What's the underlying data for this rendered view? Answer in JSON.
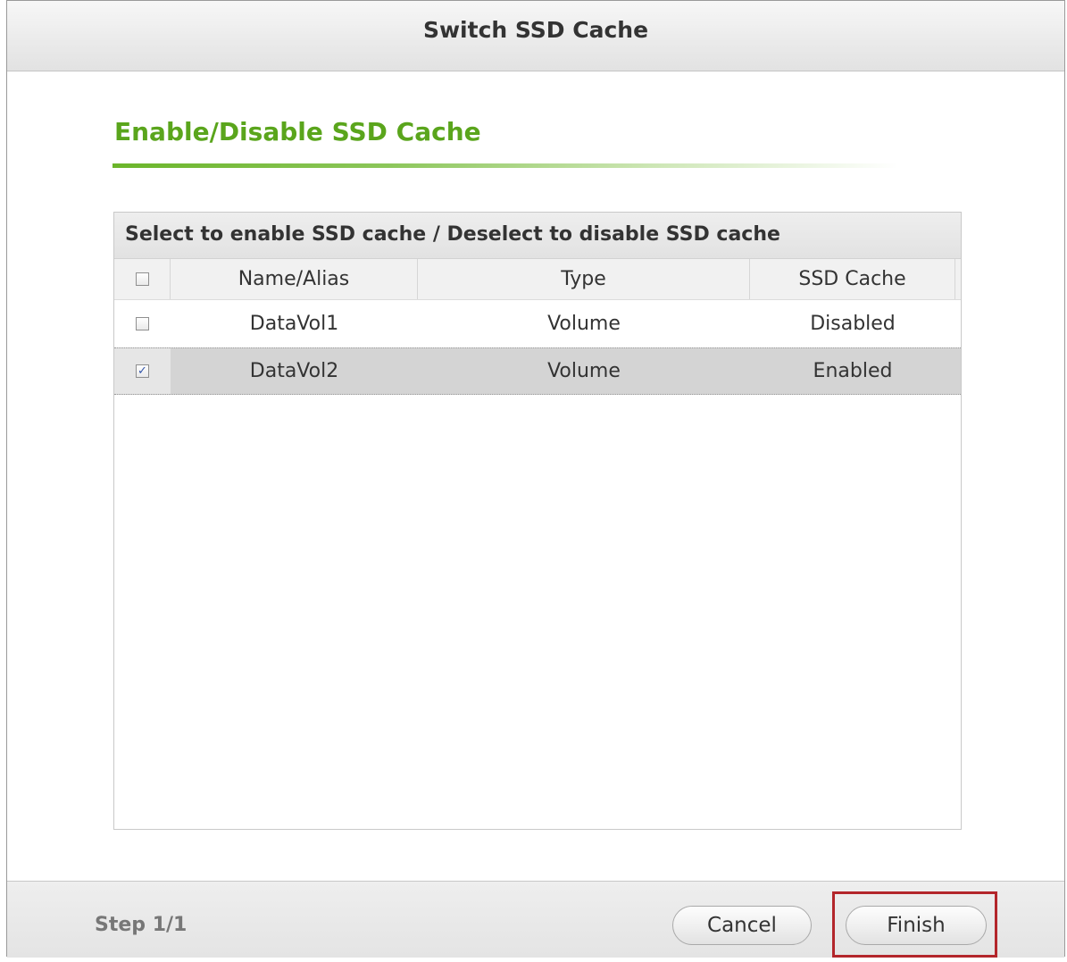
{
  "window": {
    "title": "Switch SSD Cache"
  },
  "section": {
    "title": "Enable/Disable SSD Cache"
  },
  "panel": {
    "header": "Select to enable SSD cache / Deselect to disable SSD cache",
    "columns": [
      "Name/Alias",
      "Type",
      "SSD Cache"
    ],
    "rows": [
      {
        "name": "DataVol1",
        "type": "Volume",
        "ssd_cache": "Disabled",
        "checked": false
      },
      {
        "name": "DataVol2",
        "type": "Volume",
        "ssd_cache": "Enabled",
        "checked": true
      }
    ],
    "colors": {
      "section_title": "#5aa51c",
      "selected_row": "#d4d4d4",
      "highlight_box": "#b3262b"
    }
  },
  "footer": {
    "step": "Step 1/1",
    "cancel_label": "Cancel",
    "finish_label": "Finish"
  }
}
